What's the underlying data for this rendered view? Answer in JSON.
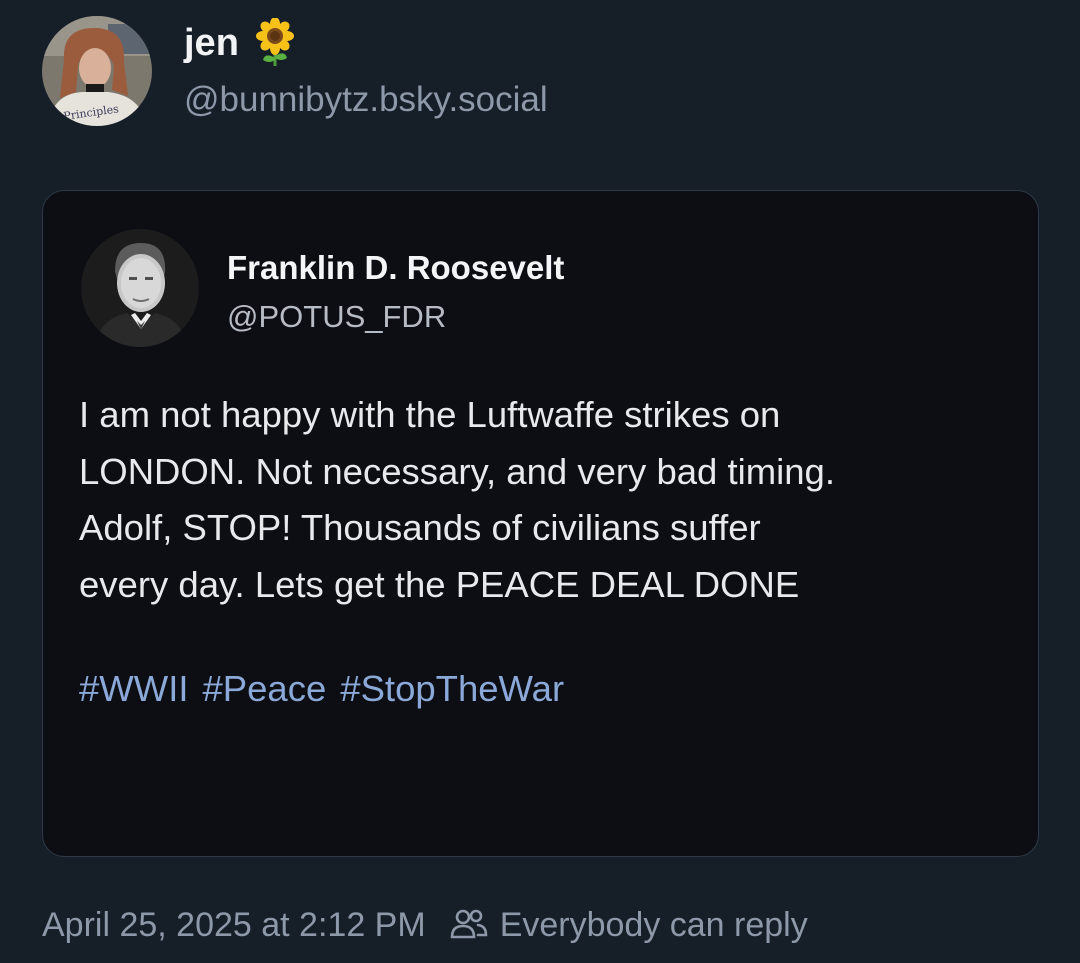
{
  "post": {
    "author": {
      "display_name": "jen",
      "handle": "@bunnibytz.bsky.social",
      "name_emoji_icon": "sunflower-icon",
      "avatar_shirt_text": "Principles"
    },
    "embed": {
      "quoted_author": {
        "name": "Franklin D. Roosevelt",
        "handle": "@POTUS_FDR"
      },
      "lines": [
        "I am not happy with the Luftwaffe strikes on",
        "LONDON. Not necessary, and very bad timing.",
        "Adolf, STOP! Thousands of civilians suffer",
        "every day. Lets get the PEACE DEAL DONE"
      ],
      "hashtags": [
        "#WWII",
        "#Peace",
        "#StopTheWar"
      ]
    },
    "timestamp": "April 25, 2025 at 2:12 PM",
    "reply_setting": "Everybody can reply",
    "reply_icon": "people-icon"
  },
  "colors": {
    "background": "#161e27",
    "card_background": "#0d0e14",
    "muted_text": "#8d99a8",
    "hashtag": "#8ba9d8"
  }
}
